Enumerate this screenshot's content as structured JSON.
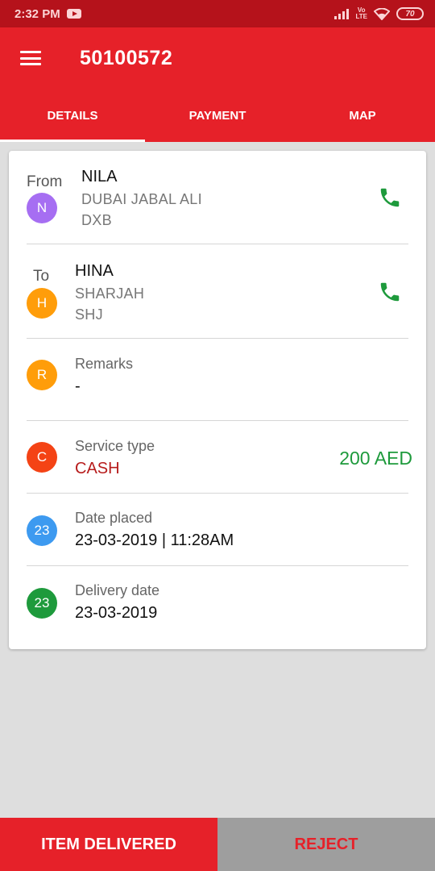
{
  "status_bar": {
    "time": "2:32 PM",
    "network": "VoLTE",
    "battery": "70"
  },
  "app_bar": {
    "menu_icon": "menu-icon",
    "title": "50100572"
  },
  "tabs": [
    {
      "label": "DETAILS",
      "active": true
    },
    {
      "label": "PAYMENT",
      "active": false
    },
    {
      "label": "MAP",
      "active": false
    }
  ],
  "details": {
    "from": {
      "caption": "From",
      "avatar_letter": "N",
      "avatar_color": "#a66ef2",
      "name": "NILA",
      "address_line1": "DUBAI JABAL ALI",
      "address_line2": "DXB",
      "action_icon": "phone-icon"
    },
    "to": {
      "caption": "To",
      "avatar_letter": "H",
      "avatar_color": "#ff9d0a",
      "name": "HINA",
      "address_line1": "SHARJAH",
      "address_line2": "SHJ",
      "action_icon": "phone-icon"
    },
    "remarks": {
      "avatar_letter": "R",
      "avatar_color": "#ff9d0a",
      "label": "Remarks",
      "value": "-"
    },
    "service_type": {
      "avatar_letter": "C",
      "avatar_color": "#f44315",
      "label": "Service type",
      "value": "CASH",
      "amount": "200 AED"
    },
    "date_placed": {
      "avatar_letter": "23",
      "avatar_color": "#3d9af0",
      "label": "Date placed",
      "value": "23-03-2019 | 11:28AM"
    },
    "delivery_date": {
      "avatar_letter": "23",
      "avatar_color": "#1e9a3c",
      "label": "Delivery date",
      "value": "23-03-2019"
    }
  },
  "colors": {
    "primary": "#e62129",
    "status_bar": "#b5121b",
    "success": "#1e9a3c",
    "reject_bg": "#9e9e9e"
  },
  "actions": {
    "deliver_label": "ITEM DELIVERED",
    "reject_label": "REJECT"
  }
}
